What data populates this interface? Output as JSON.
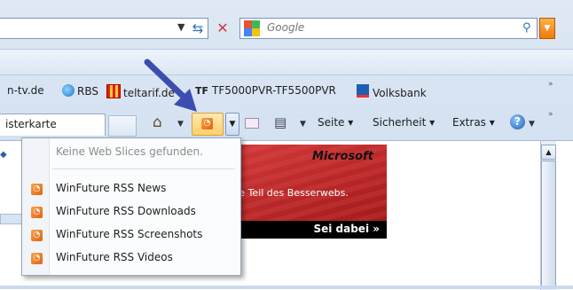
{
  "toolbar": {
    "search_placeholder": "Google",
    "search_provider_icon": "google-icon"
  },
  "favorites": [
    {
      "label": "n-tv.de",
      "icon": "page-icon"
    },
    {
      "label": "RBS",
      "icon": "ie-icon"
    },
    {
      "label": "teltarif.de",
      "icon": "teltarif-icon"
    },
    {
      "label": "TF5000PVR-TF5500PVR",
      "icon": "tf-icon",
      "mark": "TF"
    },
    {
      "label": "Volksbank",
      "icon": "volksbank-icon"
    }
  ],
  "tab": {
    "label": "isterkarte"
  },
  "commands": {
    "page": "Seite",
    "security": "Sicherheit",
    "extras": "Extras",
    "help_glyph": "?"
  },
  "feeds_menu": {
    "empty_text": "Keine Web Slices gefunden.",
    "items": [
      {
        "label": "WinFuture RSS News"
      },
      {
        "label": "WinFuture RSS Downloads"
      },
      {
        "label": "WinFuture RSS Screenshots"
      },
      {
        "label": "WinFuture RSS Videos"
      }
    ]
  },
  "ad": {
    "brand": "Microsoft",
    "text": "rde Teil des Besserwebs.",
    "cta": "Sei dabei"
  },
  "colors": {
    "accent_arrow": "#3b4eb0",
    "rss_orange": "#e2610e"
  }
}
